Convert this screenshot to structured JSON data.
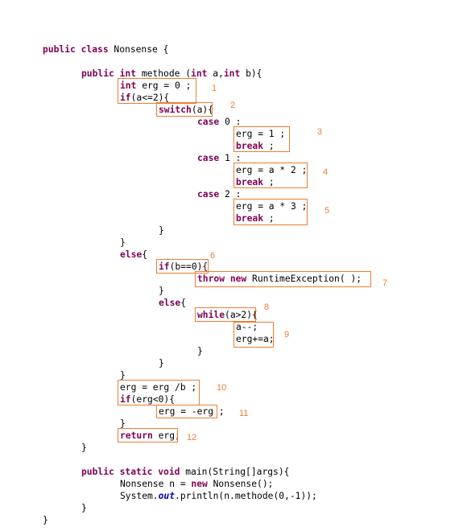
{
  "code": {
    "class_kw": "public class",
    "class_name": " Nonsense {",
    "m_pub": "public",
    "m_int": " int",
    "m_sig1": " methode (",
    "m_int2": "int",
    "m_sig2": " a,",
    "m_int3": "int",
    "m_sig3": " b){",
    "l_int": "int",
    "l_int_rest": " erg = 0 ;",
    "l_if": "if",
    "l_if_rest": "(a<=2){",
    "l_switch": "switch",
    "l_switch_rest": "(a){",
    "l_case0": "case",
    "l_case0_rest": " 0 :",
    "l_erg1": "erg = 1 ;",
    "l_break1": "break",
    "l_break1_rest": " ;",
    "l_case1": "case",
    "l_case1_rest": " 1 :",
    "l_erg2": "erg = a * 2 ;",
    "l_break2": "break",
    "l_break2_rest": " ;",
    "l_case2": "case",
    "l_case2_rest": " 2 :",
    "l_erg3": "erg = a * 3 ;",
    "l_break3": "break",
    "l_break3_rest": " ;",
    "l_close1": "}",
    "l_close2": "}",
    "l_else": "else",
    "l_else_rest": "{",
    "l_ifb": "if",
    "l_ifb_rest": "(b==0){",
    "l_throw": "throw",
    "l_new": "new",
    "l_throw_rest": " RuntimeException( );",
    "l_close3": "}",
    "l_else2": "else",
    "l_else2_rest": "{",
    "l_while": "while",
    "l_while_rest": "(a>2){",
    "l_dec": "a--;",
    "l_ergplus": "erg+=a;",
    "l_close4": "}",
    "l_close5": "}",
    "l_close6": "}",
    "l_div": "erg = erg /b ;",
    "l_iferg": "if",
    "l_iferg_rest": "(erg<0){",
    "l_neg": "erg = -erg",
    "l_neg_rest": " ;",
    "l_close7": "}",
    "l_return": "return",
    "l_return_rest": " erg;",
    "l_close8": "}",
    "main_pub": "public static void",
    "main_rest": " main(String[]args){",
    "main_l1a": "Nonsense n = ",
    "main_new": "new",
    "main_l1b": " Nonsense();",
    "main_l2a": "System.",
    "main_out": "out",
    "main_l2b": ".println(n.methode(0,-1));",
    "main_close": "}",
    "class_close": "}"
  },
  "annotations": [
    "1",
    "2",
    "3",
    "4",
    "5",
    "6",
    "7",
    "8",
    "9",
    "10",
    "11",
    "12"
  ],
  "colors": {
    "keyword": "#7f0055",
    "field": "#0000c0",
    "annotation": "#ed7d31"
  }
}
